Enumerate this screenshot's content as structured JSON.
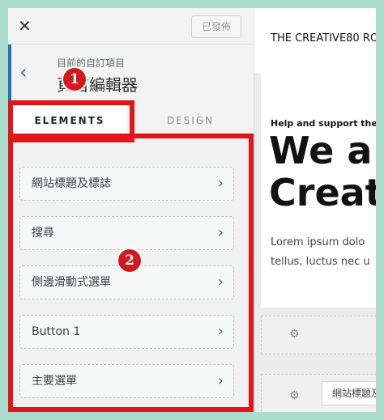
{
  "header": {
    "close_icon": "close-icon",
    "close_glyph": "✕",
    "published_label": "已發佈",
    "back_icon": "chevron-left-icon",
    "back_glyph": "‹",
    "breadcrumb": "目前的自訂項目",
    "title": "頁首編輯器"
  },
  "tabs": [
    {
      "label": "ELEMENTS",
      "active": true
    },
    {
      "label": "DESIGN",
      "active": false
    }
  ],
  "elements": [
    {
      "label": "網站標題及標誌",
      "icon": "chevron-right-icon"
    },
    {
      "label": "搜尋",
      "icon": "chevron-right-icon"
    },
    {
      "label": "側邊滑動式選單",
      "icon": "chevron-right-icon"
    },
    {
      "label": "Button 1",
      "icon": "chevron-right-icon"
    },
    {
      "label": "主要選單",
      "icon": "chevron-right-icon"
    }
  ],
  "chevron_glyph": "›",
  "preview": {
    "site_title": "THE CREATIVE80 RO",
    "tagline": "Help and support the",
    "hero_line1": "We a",
    "hero_line2": "Creat",
    "para_line1": "Lorem ipsum dolo",
    "para_line2": "tellus, luctus nec u",
    "gear_glyph": "⚙",
    "builder_item": "網站標題及標誌"
  },
  "annotations": {
    "badge1": "1",
    "badge2": "2",
    "color": "#e3141a"
  }
}
